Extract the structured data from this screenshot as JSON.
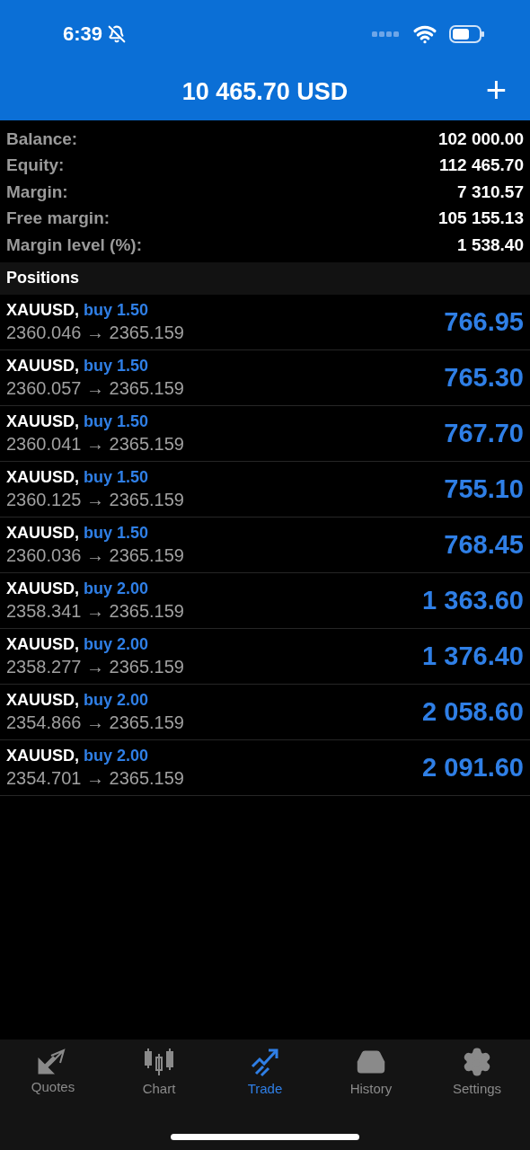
{
  "status_bar": {
    "time": "6:39"
  },
  "header": {
    "title": "10 465.70 USD",
    "add_button": "+"
  },
  "summary": [
    {
      "label": "Balance:",
      "value": "102 000.00"
    },
    {
      "label": "Equity:",
      "value": "112 465.70"
    },
    {
      "label": "Margin:",
      "value": "7 310.57"
    },
    {
      "label": "Free margin:",
      "value": "105 155.13"
    },
    {
      "label": "Margin level (%):",
      "value": "1 538.40"
    }
  ],
  "positions_header": "Positions",
  "positions": [
    {
      "symbol": "XAUUSD,",
      "order": "buy 1.50",
      "prices": "2360.046 → 2365.159",
      "profit": "766.95"
    },
    {
      "symbol": "XAUUSD,",
      "order": "buy 1.50",
      "prices": "2360.057 → 2365.159",
      "profit": "765.30"
    },
    {
      "symbol": "XAUUSD,",
      "order": "buy 1.50",
      "prices": "2360.041 → 2365.159",
      "profit": "767.70"
    },
    {
      "symbol": "XAUUSD,",
      "order": "buy 1.50",
      "prices": "2360.125 → 2365.159",
      "profit": "755.10"
    },
    {
      "symbol": "XAUUSD,",
      "order": "buy 1.50",
      "prices": "2360.036 → 2365.159",
      "profit": "768.45"
    },
    {
      "symbol": "XAUUSD,",
      "order": "buy 2.00",
      "prices": "2358.341 → 2365.159",
      "profit": "1 363.60"
    },
    {
      "symbol": "XAUUSD,",
      "order": "buy 2.00",
      "prices": "2358.277 → 2365.159",
      "profit": "1 376.40"
    },
    {
      "symbol": "XAUUSD,",
      "order": "buy 2.00",
      "prices": "2354.866 → 2365.159",
      "profit": "2 058.60"
    },
    {
      "symbol": "XAUUSD,",
      "order": "buy 2.00",
      "prices": "2354.701 → 2365.159",
      "profit": "2 091.60"
    }
  ],
  "tabs": [
    {
      "kind": "quotes",
      "label": "Quotes",
      "selected": false
    },
    {
      "kind": "chart",
      "label": "Chart",
      "selected": false
    },
    {
      "kind": "trade",
      "label": "Trade",
      "selected": true
    },
    {
      "kind": "history",
      "label": "History",
      "selected": false
    },
    {
      "kind": "settings",
      "label": "Settings",
      "selected": false
    }
  ]
}
